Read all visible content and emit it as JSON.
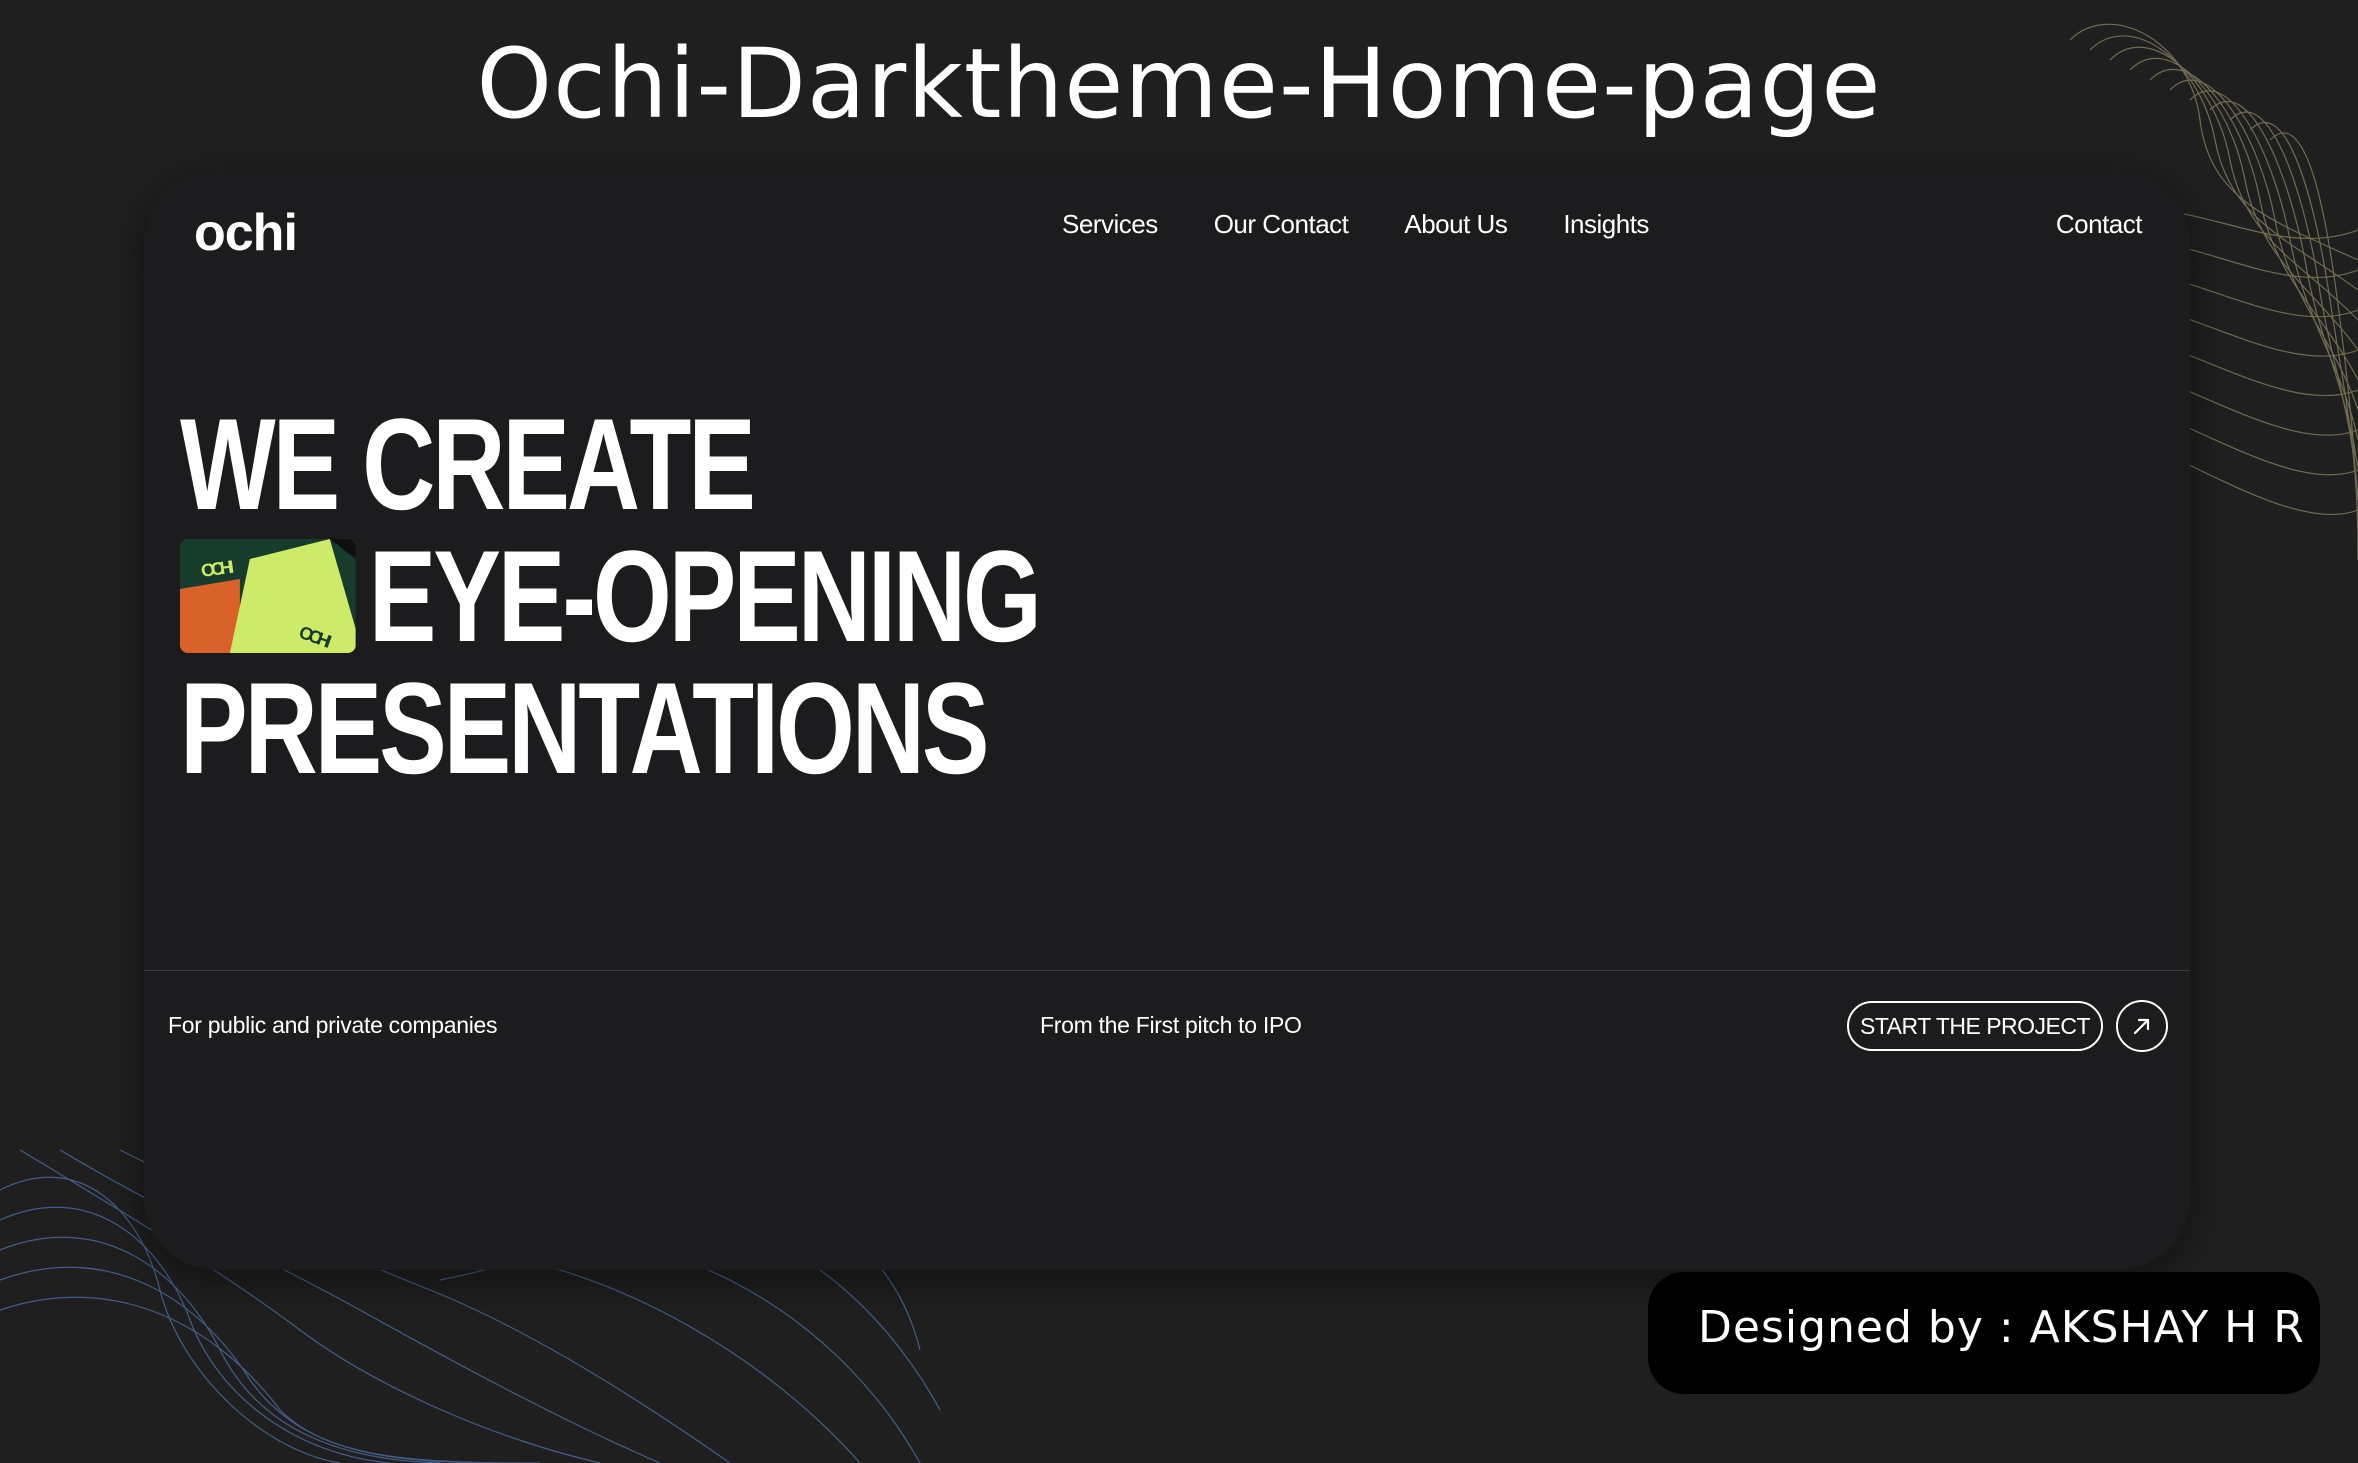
{
  "showcase": {
    "title": "Ochi-Darktheme-Home-page",
    "credit": "Designed by : AKSHAY H R"
  },
  "header": {
    "logo": "ochi",
    "nav": [
      {
        "label": "Services"
      },
      {
        "label": "Our Contact"
      },
      {
        "label": "About Us"
      },
      {
        "label": "Insights"
      }
    ],
    "contact_label": "Contact"
  },
  "hero": {
    "line1": "WE CREATE",
    "line2": "EYE-OPENING",
    "line3": "PRESENTATIONS",
    "thumbnail_brand": "ochi"
  },
  "footer_bar": {
    "left_text": "For public and private companies",
    "middle_text": "From the First pitch to IPO",
    "cta_label": "START THE PROJECT",
    "arrow_icon": "arrow-up-right-icon"
  },
  "colors": {
    "page_background": "#1f1f1f",
    "screen_background": "#1c1c1e",
    "text": "#ffffff",
    "thumb_dark_green": "#173c2c",
    "thumb_lime": "#cdea68",
    "thumb_orange": "#d9622b",
    "deco_top_right_lines": "#8a8560",
    "deco_bottom_left_lines": "#4a6a9a"
  }
}
